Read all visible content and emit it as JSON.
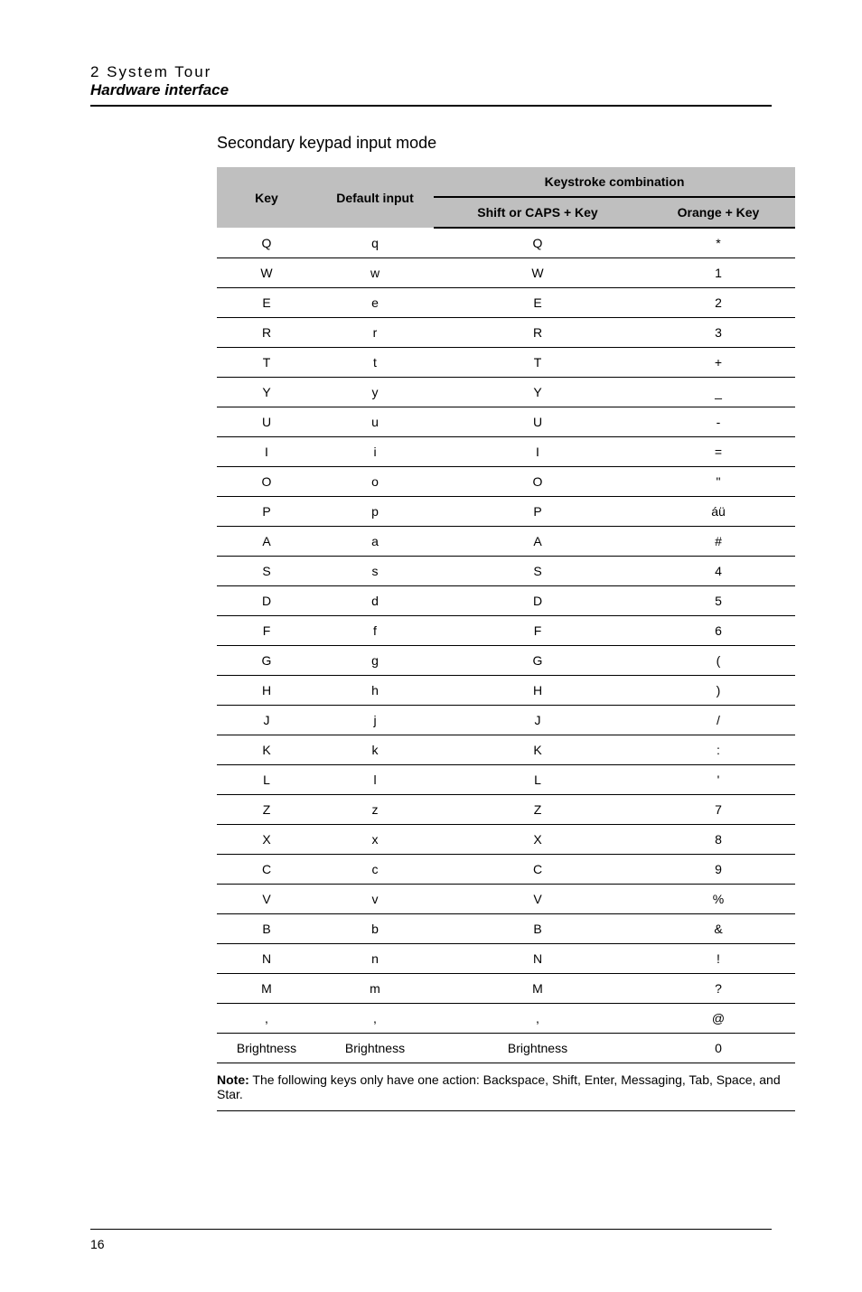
{
  "header": {
    "chapter": "2  System  Tour",
    "subsection": "Hardware interface"
  },
  "section_title": "Secondary keypad input mode",
  "table": {
    "headers": {
      "key": "Key",
      "default_input": "Default input",
      "combo": "Keystroke combination",
      "shift_caps": "Shift or CAPS + Key",
      "orange": "Orange + Key"
    },
    "rows": [
      {
        "key": "Q",
        "default": "q",
        "shift": "Q",
        "orange": "*"
      },
      {
        "key": "W",
        "default": "w",
        "shift": "W",
        "orange": "1"
      },
      {
        "key": "E",
        "default": "e",
        "shift": "E",
        "orange": "2"
      },
      {
        "key": "R",
        "default": "r",
        "shift": "R",
        "orange": "3"
      },
      {
        "key": "T",
        "default": "t",
        "shift": "T",
        "orange": "+"
      },
      {
        "key": "Y",
        "default": "y",
        "shift": "Y",
        "orange": "_"
      },
      {
        "key": "U",
        "default": "u",
        "shift": "U",
        "orange": "-"
      },
      {
        "key": "I",
        "default": "i",
        "shift": "I",
        "orange": "="
      },
      {
        "key": "O",
        "default": "o",
        "shift": "O",
        "orange": "\""
      },
      {
        "key": "P",
        "default": "p",
        "shift": "P",
        "orange": "áü"
      },
      {
        "key": "A",
        "default": "a",
        "shift": "A",
        "orange": "#"
      },
      {
        "key": "S",
        "default": "s",
        "shift": "S",
        "orange": "4"
      },
      {
        "key": "D",
        "default": "d",
        "shift": "D",
        "orange": "5"
      },
      {
        "key": "F",
        "default": "f",
        "shift": "F",
        "orange": "6"
      },
      {
        "key": "G",
        "default": "g",
        "shift": "G",
        "orange": "("
      },
      {
        "key": "H",
        "default": "h",
        "shift": "H",
        "orange": ")"
      },
      {
        "key": "J",
        "default": "j",
        "shift": "J",
        "orange": "/"
      },
      {
        "key": "K",
        "default": "k",
        "shift": "K",
        "orange": ":"
      },
      {
        "key": "L",
        "default": "l",
        "shift": "L",
        "orange": "'"
      },
      {
        "key": "Z",
        "default": "z",
        "shift": "Z",
        "orange": "7"
      },
      {
        "key": "X",
        "default": "x",
        "shift": "X",
        "orange": "8"
      },
      {
        "key": "C",
        "default": "c",
        "shift": "C",
        "orange": "9"
      },
      {
        "key": "V",
        "default": "v",
        "shift": "V",
        "orange": "%"
      },
      {
        "key": "B",
        "default": "b",
        "shift": "B",
        "orange": "&"
      },
      {
        "key": "N",
        "default": "n",
        "shift": "N",
        "orange": "!"
      },
      {
        "key": "M",
        "default": "m",
        "shift": "M",
        "orange": "?"
      },
      {
        "key": ",",
        "default": ",",
        "shift": ",",
        "orange": "@"
      },
      {
        "key": "Brightness",
        "default": "Brightness",
        "shift": "Brightness",
        "orange": "0"
      }
    ]
  },
  "note_label": "Note:",
  "note_text": " The following keys only have one action: Backspace, Shift, Enter, Messaging, Tab, Space, and Star.",
  "page_number": "16"
}
